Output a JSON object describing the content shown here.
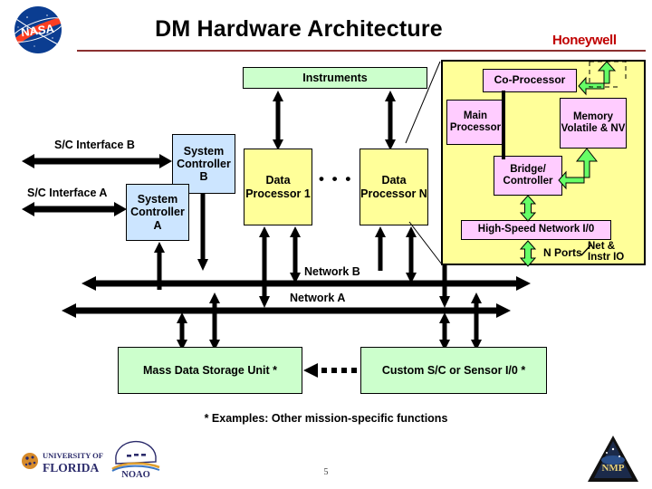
{
  "slide": {
    "title": "DM Hardware Architecture",
    "vendor_logo": "Honeywell",
    "page_number": "5",
    "footnote": "* Examples: Other mission-specific functions",
    "rule_color": "#8b3030",
    "vendor_color": "#c00000"
  },
  "logos": {
    "nasa": "nasa-meatball-logo",
    "university": "UNIVERSITY OF",
    "university2": "FLORIDA",
    "observatory": "NOAO",
    "program": "NMP"
  },
  "diagram": {
    "instruments": "Instruments",
    "sc_interface_b": "S/C Interface B",
    "sc_interface_a": "S/C Interface A",
    "system_controller_b": "System Controller B",
    "system_controller_a": "System Controller A",
    "data_processor_1": "Data Processor 1",
    "data_processor_n": "Data Processor N",
    "ellipsis": "• • •",
    "network_b": "Network B",
    "network_a": "Network A",
    "mass_storage": "Mass Data Storage Unit *",
    "custom_io": "Custom S/C or Sensor I/0 *"
  },
  "detail_panel": {
    "co_processor": "Co-Processor",
    "main_processor": "Main Processor",
    "memory": "Memory Volatile & NV",
    "bridge_controller": "Bridge/ Controller",
    "network_io": "High-Speed Network I/0",
    "n_ports": "N Ports",
    "net_instr_io": "Net & Instr IO"
  },
  "colors": {
    "green_box": "#ccffcc",
    "yellow_box": "#ffff99",
    "blue_box": "#cce5ff",
    "pink_box": "#ffccff",
    "green_arrow": "#66ff66",
    "black": "#000000"
  }
}
